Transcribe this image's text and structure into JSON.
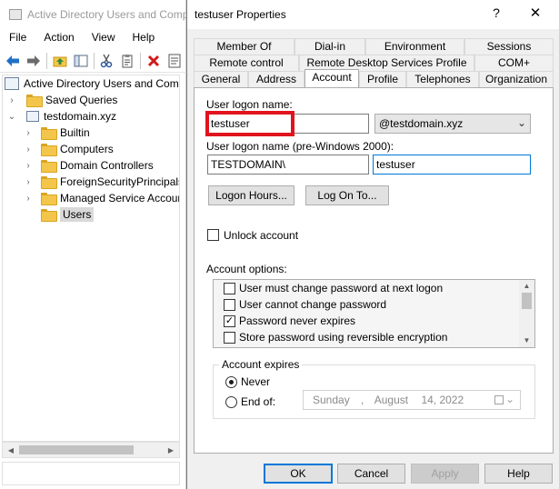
{
  "aduc": {
    "title": "Active Directory Users and Computers",
    "menu": [
      "File",
      "Action",
      "View",
      "Help"
    ],
    "toolbar_icons": [
      "back-arrow-icon",
      "forward-arrow-icon",
      "up-folder-icon",
      "console-tree-icon",
      "cut-icon",
      "clipboard-icon",
      "delete-icon",
      "properties-icon"
    ],
    "tree": {
      "root": "Active Directory Users and Computers",
      "saved_queries": "Saved Queries",
      "domain": "testdomain.xyz",
      "children": [
        "Builtin",
        "Computers",
        "Domain Controllers",
        "ForeignSecurityPrincipals",
        "Managed Service Accounts",
        "Users"
      ],
      "selected": "Users"
    }
  },
  "dialog": {
    "title": "testuser Properties",
    "help_glyph": "?",
    "close_glyph": "✕",
    "tabs_row1": [
      "Member Of",
      "Dial-in",
      "Environment",
      "Sessions"
    ],
    "tabs_row2": [
      "Remote control",
      "Remote Desktop Services Profile",
      "COM+"
    ],
    "tabs_row3": [
      "General",
      "Address",
      "Account",
      "Profile",
      "Telephones",
      "Organization"
    ],
    "active_tab": "Account",
    "account": {
      "logon_name_label": "User logon name:",
      "logon_name_value": "testuser",
      "domain_suffix": "@testdomain.xyz",
      "pre2000_label": "User logon name (pre-Windows 2000):",
      "pre2000_domain": "TESTDOMAIN\\",
      "pre2000_user": "testuser",
      "logon_hours_button": "Logon Hours...",
      "log_on_to_button": "Log On To...",
      "unlock_label": "Unlock account",
      "unlock_checked": false,
      "options_label": "Account options:",
      "options": [
        {
          "label": "User must change password at next logon",
          "checked": false
        },
        {
          "label": "User cannot change password",
          "checked": false
        },
        {
          "label": "Password never expires",
          "checked": true
        },
        {
          "label": "Store password using reversible encryption",
          "checked": false
        }
      ],
      "expires_group_label": "Account expires",
      "never_label": "Never",
      "end_of_label": "End of:",
      "expires_selected": "Never",
      "end_date": {
        "weekday": "Sunday",
        "sep": ",",
        "month": "August",
        "day": "14, 2022"
      }
    },
    "buttons": {
      "ok": "OK",
      "cancel": "Cancel",
      "apply": "Apply",
      "help": "Help"
    }
  }
}
